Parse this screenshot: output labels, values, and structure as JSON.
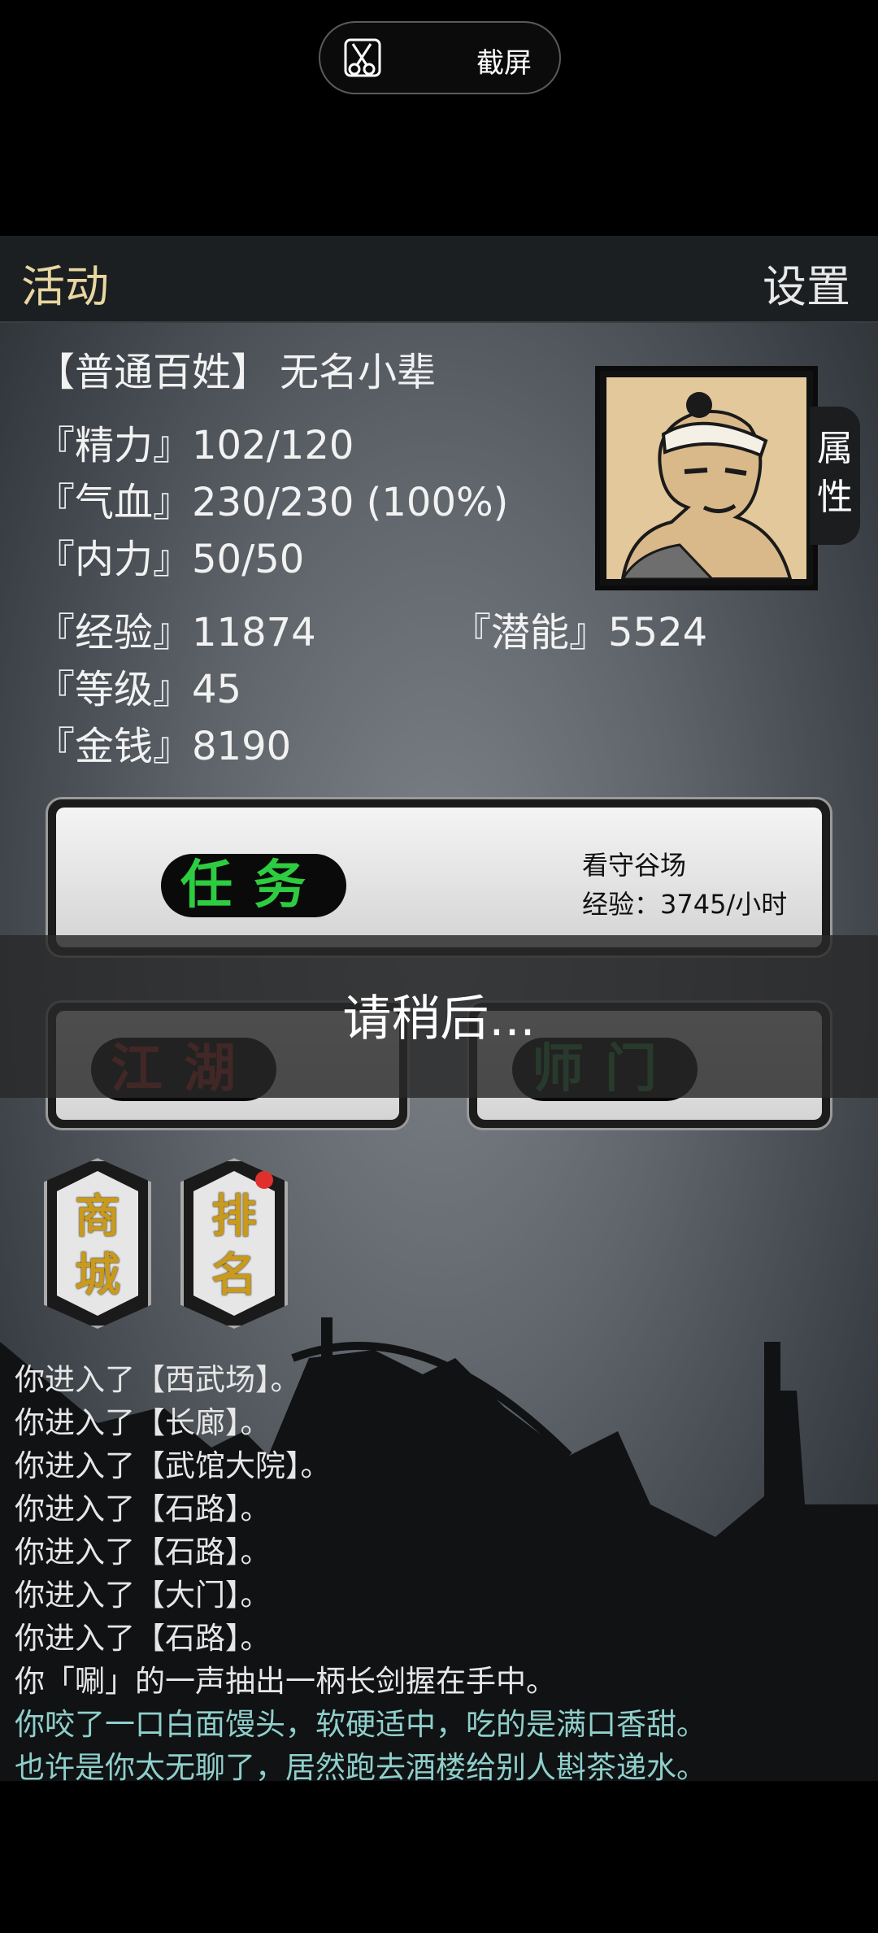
{
  "screenshot_bar": {
    "label": "截屏"
  },
  "topbar": {
    "left": "活动",
    "right": "设置"
  },
  "character": {
    "title": "【普通百姓】",
    "name": "无名小辈",
    "stats": {
      "jingli": "『精力』102/120",
      "qixue": "『气血』230/230 (100%)",
      "neili": "『内力』50/50",
      "jingyan": "『经验』11874",
      "qianneng": "『潜能』5524",
      "dengji": "『等级』45",
      "jinqian": "『金钱』8190"
    },
    "attr_tab": [
      "属",
      "性"
    ]
  },
  "task": {
    "button": "任务",
    "place": "看守谷场",
    "exp": "经验：3745/小时"
  },
  "buttons": {
    "jianghu": "江湖",
    "shimen": "师门"
  },
  "overlay": {
    "text": "请稍后..."
  },
  "side_buttons": {
    "shop": [
      "商",
      "城"
    ],
    "rank": [
      "排",
      "名"
    ]
  },
  "log": [
    "你进入了【西武场】。",
    "你进入了【长廊】。",
    "你进入了【武馆大院】。",
    "你进入了【石路】。",
    "你进入了【石路】。",
    "你进入了【大门】。",
    "你进入了【石路】。",
    "你「唰」的一声抽出一柄长剑握在手中。",
    "你咬了一口白面馒头，软硬适中，吃的是满口香甜。",
    "也许是你太无聊了，居然跑去酒楼给别人斟茶递水。"
  ],
  "colors": {
    "gold": "#e8d7a0",
    "green": "#2ecc40",
    "red": "#b2231f",
    "teal": "#8fcfcb"
  }
}
